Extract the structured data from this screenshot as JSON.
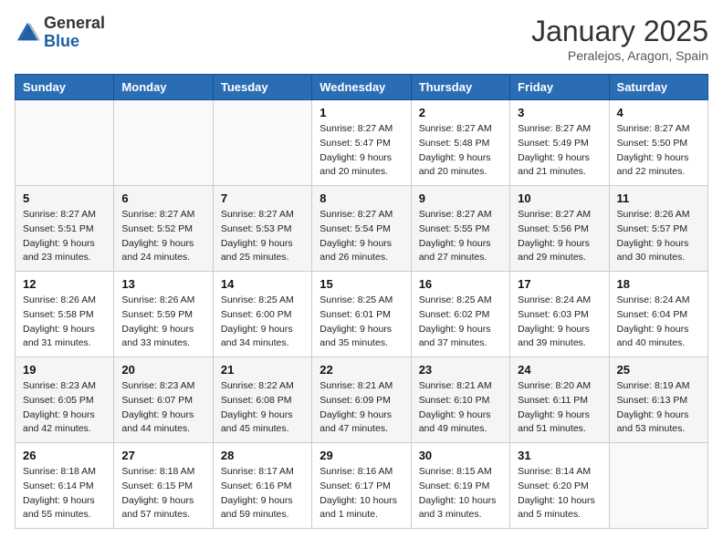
{
  "header": {
    "logo_general": "General",
    "logo_blue": "Blue",
    "month_title": "January 2025",
    "location": "Peralejos, Aragon, Spain"
  },
  "days_of_week": [
    "Sunday",
    "Monday",
    "Tuesday",
    "Wednesday",
    "Thursday",
    "Friday",
    "Saturday"
  ],
  "weeks": [
    [
      {
        "day": "",
        "info": ""
      },
      {
        "day": "",
        "info": ""
      },
      {
        "day": "",
        "info": ""
      },
      {
        "day": "1",
        "info": "Sunrise: 8:27 AM\nSunset: 5:47 PM\nDaylight: 9 hours\nand 20 minutes."
      },
      {
        "day": "2",
        "info": "Sunrise: 8:27 AM\nSunset: 5:48 PM\nDaylight: 9 hours\nand 20 minutes."
      },
      {
        "day": "3",
        "info": "Sunrise: 8:27 AM\nSunset: 5:49 PM\nDaylight: 9 hours\nand 21 minutes."
      },
      {
        "day": "4",
        "info": "Sunrise: 8:27 AM\nSunset: 5:50 PM\nDaylight: 9 hours\nand 22 minutes."
      }
    ],
    [
      {
        "day": "5",
        "info": "Sunrise: 8:27 AM\nSunset: 5:51 PM\nDaylight: 9 hours\nand 23 minutes."
      },
      {
        "day": "6",
        "info": "Sunrise: 8:27 AM\nSunset: 5:52 PM\nDaylight: 9 hours\nand 24 minutes."
      },
      {
        "day": "7",
        "info": "Sunrise: 8:27 AM\nSunset: 5:53 PM\nDaylight: 9 hours\nand 25 minutes."
      },
      {
        "day": "8",
        "info": "Sunrise: 8:27 AM\nSunset: 5:54 PM\nDaylight: 9 hours\nand 26 minutes."
      },
      {
        "day": "9",
        "info": "Sunrise: 8:27 AM\nSunset: 5:55 PM\nDaylight: 9 hours\nand 27 minutes."
      },
      {
        "day": "10",
        "info": "Sunrise: 8:27 AM\nSunset: 5:56 PM\nDaylight: 9 hours\nand 29 minutes."
      },
      {
        "day": "11",
        "info": "Sunrise: 8:26 AM\nSunset: 5:57 PM\nDaylight: 9 hours\nand 30 minutes."
      }
    ],
    [
      {
        "day": "12",
        "info": "Sunrise: 8:26 AM\nSunset: 5:58 PM\nDaylight: 9 hours\nand 31 minutes."
      },
      {
        "day": "13",
        "info": "Sunrise: 8:26 AM\nSunset: 5:59 PM\nDaylight: 9 hours\nand 33 minutes."
      },
      {
        "day": "14",
        "info": "Sunrise: 8:25 AM\nSunset: 6:00 PM\nDaylight: 9 hours\nand 34 minutes."
      },
      {
        "day": "15",
        "info": "Sunrise: 8:25 AM\nSunset: 6:01 PM\nDaylight: 9 hours\nand 35 minutes."
      },
      {
        "day": "16",
        "info": "Sunrise: 8:25 AM\nSunset: 6:02 PM\nDaylight: 9 hours\nand 37 minutes."
      },
      {
        "day": "17",
        "info": "Sunrise: 8:24 AM\nSunset: 6:03 PM\nDaylight: 9 hours\nand 39 minutes."
      },
      {
        "day": "18",
        "info": "Sunrise: 8:24 AM\nSunset: 6:04 PM\nDaylight: 9 hours\nand 40 minutes."
      }
    ],
    [
      {
        "day": "19",
        "info": "Sunrise: 8:23 AM\nSunset: 6:05 PM\nDaylight: 9 hours\nand 42 minutes."
      },
      {
        "day": "20",
        "info": "Sunrise: 8:23 AM\nSunset: 6:07 PM\nDaylight: 9 hours\nand 44 minutes."
      },
      {
        "day": "21",
        "info": "Sunrise: 8:22 AM\nSunset: 6:08 PM\nDaylight: 9 hours\nand 45 minutes."
      },
      {
        "day": "22",
        "info": "Sunrise: 8:21 AM\nSunset: 6:09 PM\nDaylight: 9 hours\nand 47 minutes."
      },
      {
        "day": "23",
        "info": "Sunrise: 8:21 AM\nSunset: 6:10 PM\nDaylight: 9 hours\nand 49 minutes."
      },
      {
        "day": "24",
        "info": "Sunrise: 8:20 AM\nSunset: 6:11 PM\nDaylight: 9 hours\nand 51 minutes."
      },
      {
        "day": "25",
        "info": "Sunrise: 8:19 AM\nSunset: 6:13 PM\nDaylight: 9 hours\nand 53 minutes."
      }
    ],
    [
      {
        "day": "26",
        "info": "Sunrise: 8:18 AM\nSunset: 6:14 PM\nDaylight: 9 hours\nand 55 minutes."
      },
      {
        "day": "27",
        "info": "Sunrise: 8:18 AM\nSunset: 6:15 PM\nDaylight: 9 hours\nand 57 minutes."
      },
      {
        "day": "28",
        "info": "Sunrise: 8:17 AM\nSunset: 6:16 PM\nDaylight: 9 hours\nand 59 minutes."
      },
      {
        "day": "29",
        "info": "Sunrise: 8:16 AM\nSunset: 6:17 PM\nDaylight: 10 hours\nand 1 minute."
      },
      {
        "day": "30",
        "info": "Sunrise: 8:15 AM\nSunset: 6:19 PM\nDaylight: 10 hours\nand 3 minutes."
      },
      {
        "day": "31",
        "info": "Sunrise: 8:14 AM\nSunset: 6:20 PM\nDaylight: 10 hours\nand 5 minutes."
      },
      {
        "day": "",
        "info": ""
      }
    ]
  ]
}
